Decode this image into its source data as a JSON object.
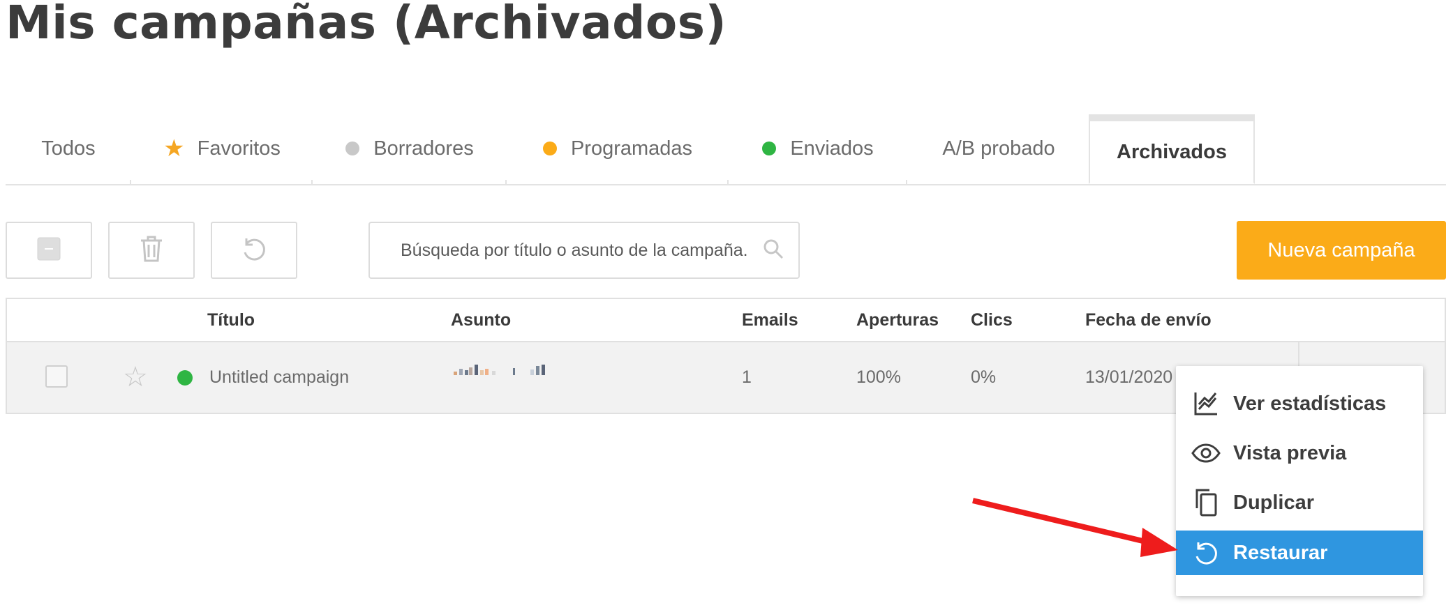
{
  "page": {
    "title": "Mis campañas (Archivados)"
  },
  "tabs": [
    {
      "label": "Todos",
      "indicator": "none"
    },
    {
      "label": "Favoritos",
      "indicator": "star",
      "color": "#f5a623"
    },
    {
      "label": "Borradores",
      "indicator": "dot",
      "color": "#c8c8c8"
    },
    {
      "label": "Programadas",
      "indicator": "dot",
      "color": "#fbab18"
    },
    {
      "label": "Enviados",
      "indicator": "dot",
      "color": "#2fb543"
    },
    {
      "label": "A/B probado",
      "indicator": "none"
    },
    {
      "label": "Archivados",
      "indicator": "none",
      "active": true
    }
  ],
  "toolbar": {
    "select_icon": "minus-checkbox-icon",
    "delete_icon": "trash-icon",
    "restore_icon": "restore-icon",
    "search_placeholder": "Búsqueda por título o asunto de la campaña.",
    "new_campaign_label": "Nueva campaña",
    "new_campaign_color": "#fbab18"
  },
  "table": {
    "columns": [
      "Título",
      "Asunto",
      "Emails",
      "Aperturas",
      "Clics",
      "Fecha de envío"
    ],
    "rows": [
      {
        "favorite": false,
        "status_color": "#2fb543",
        "title": "Untitled campaign",
        "subject": "",
        "emails": "1",
        "opens": "100%",
        "clicks": "0%",
        "date": "13/01/2020"
      }
    ]
  },
  "menu": {
    "items": [
      {
        "label": "Ver estadísticas",
        "icon": "chart-line-icon"
      },
      {
        "label": "Vista previa",
        "icon": "eye-icon"
      },
      {
        "label": "Duplicar",
        "icon": "copy-icon"
      },
      {
        "label": "Restaurar",
        "icon": "restore-icon",
        "highlighted": true
      }
    ],
    "highlight_color": "#2f96e0"
  },
  "annotation": {
    "arrow_color": "#ee1c1c",
    "arrow_target": "Restaurar"
  }
}
